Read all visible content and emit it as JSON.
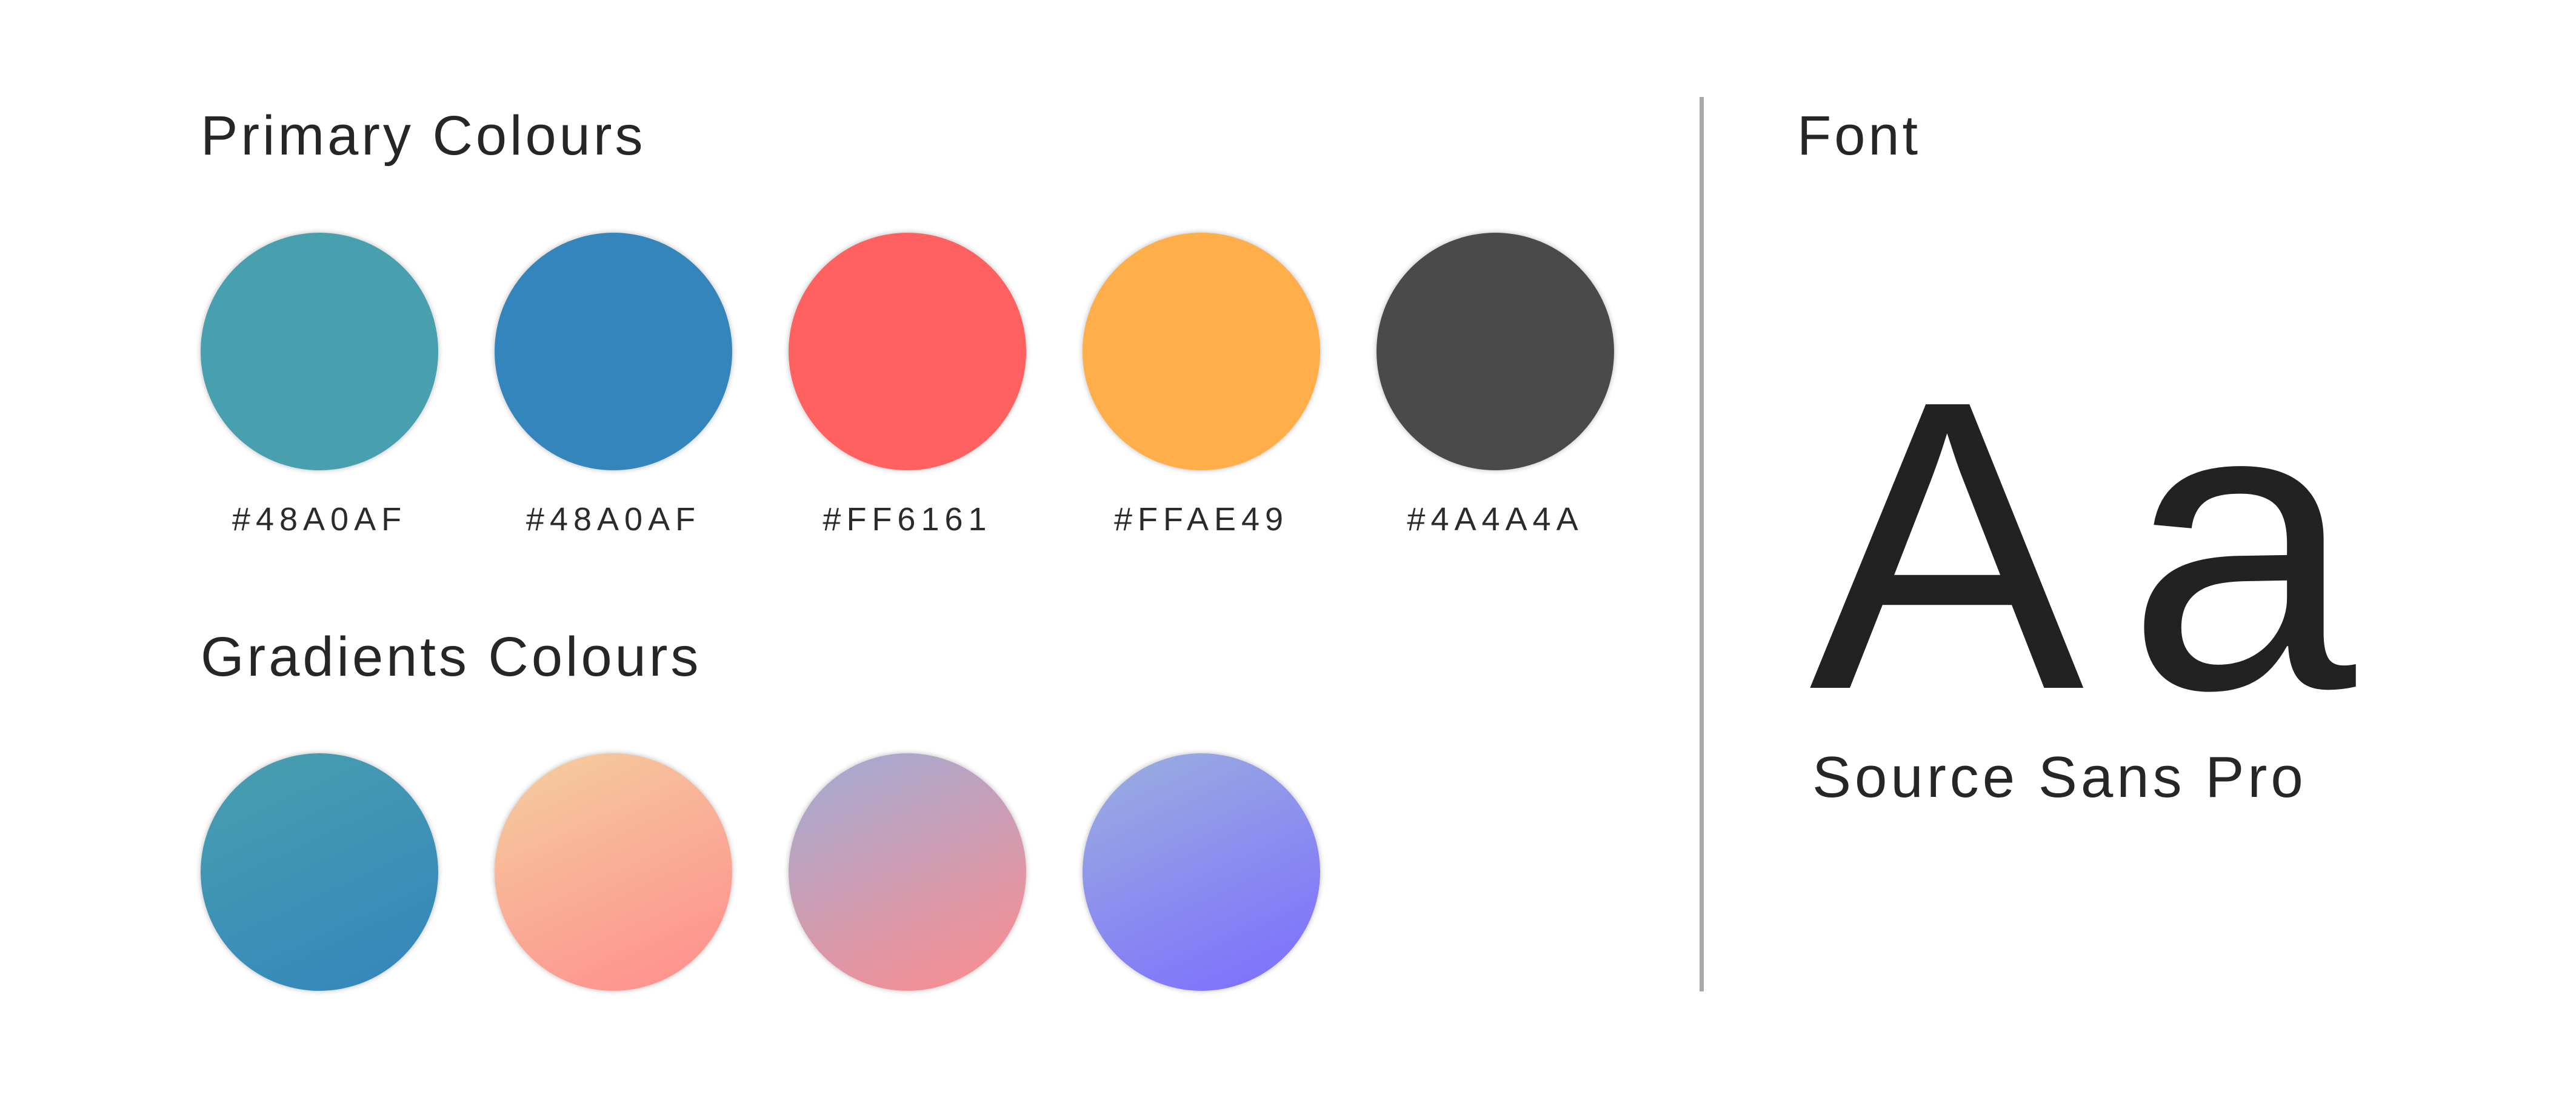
{
  "primary": {
    "heading": "Primary Colours",
    "swatches": [
      {
        "label": "#48A0AF",
        "color": "#48A0AF"
      },
      {
        "label": "#48A0AF",
        "color": "#3485BB"
      },
      {
        "label": "#FF6161",
        "color": "#FF6161"
      },
      {
        "label": "#FFAE49",
        "color": "#FFAE49"
      },
      {
        "label": "#4A4A4A",
        "color": "#4A4A4A"
      }
    ]
  },
  "gradients": {
    "heading": "Gradients Colours",
    "swatches": [
      {
        "from": "#48A0AF",
        "to": "#3485BB"
      },
      {
        "from": "#F4CF9F",
        "to": "#FF8C8C"
      },
      {
        "from": "#9EACD6",
        "to": "#FF8C8C"
      },
      {
        "from": "#9BB0DE",
        "to": "#7B6CFF"
      }
    ]
  },
  "font": {
    "heading": "Font",
    "sample": "Aa",
    "name": "Source Sans Pro"
  }
}
